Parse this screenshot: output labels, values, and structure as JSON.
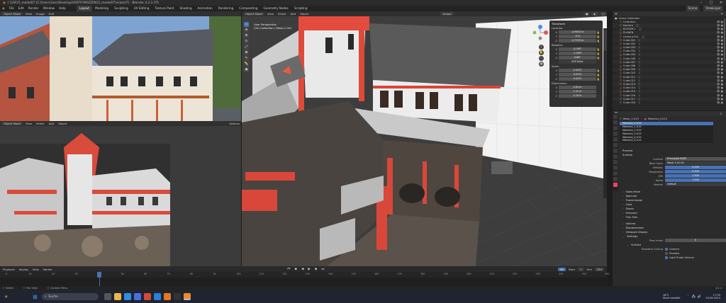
{
  "window": {
    "title": "[ 1GR15_model07 [C:\\Users\\User\\Desktop\\VERTIF\\MOZZIN15_model07\\vilamil7] - Blender 4.2.3 LTS",
    "controls": [
      "–",
      "□",
      "✕"
    ]
  },
  "menu": {
    "items": [
      "File",
      "Edit",
      "Render",
      "Window",
      "Help"
    ],
    "workspaces": [
      "Layout",
      "Modeling",
      "Sculpting",
      "UV Editing",
      "Texture Paint",
      "Shading",
      "Animation",
      "Rendering",
      "Compositing",
      "Geometry Nodes",
      "Scripting"
    ],
    "active_workspace": "Layout",
    "scene_label": "Scene",
    "view_layer_label": "ViewLayer"
  },
  "image_editor": {
    "mode": "Object Mode",
    "items": [
      "View",
      "Image",
      "Edit"
    ]
  },
  "render_editor": {
    "mode": "Object Mode",
    "items": [
      "View",
      "Select",
      "Add",
      "Object"
    ],
    "options_label": "Options"
  },
  "viewport": {
    "mode": "Object Mode",
    "items": [
      "View",
      "Select",
      "Add",
      "Object"
    ],
    "shading": "Global",
    "overlay_title": "User Perspective",
    "overlay_subtitle": "(34) Collection | Mesh.1.001"
  },
  "npanel": {
    "title": "Transform",
    "location_label": "Location:",
    "location": [
      "-4.9903 m",
      "-0 m",
      "-2.7533 m"
    ],
    "rotation_label": "Rotation:",
    "rotation": [
      "-0.762°",
      "-1.099°",
      "0.86°"
    ],
    "rotation_mode": "XYZ Euler",
    "scale_label": "Scale:",
    "scale": [
      "0.0372",
      "0.0372",
      "0.0372"
    ],
    "dimensions_label": "Dimensions:",
    "dimensions": [
      "4.04 m",
      "1.22 m",
      "0.76 m"
    ],
    "axes": [
      "X",
      "Y",
      "Z"
    ]
  },
  "outliner": {
    "root": "Scene Collection",
    "items": [
      {
        "name": "Collection",
        "mat": ""
      },
      {
        "name": "Kamera",
        "mat": "◯"
      },
      {
        "name": "BOSSER.1",
        "mat": "◯"
      },
      {
        "name": "PLANEN",
        "mat": ""
      },
      {
        "name": "Camera.001",
        "mat": "◯"
      },
      {
        "name": "Cube.001",
        "mat": "▽"
      },
      {
        "name": "Cube.002",
        "mat": "▽"
      },
      {
        "name": "Cube.003",
        "mat": "▽"
      },
      {
        "name": "Cube.004",
        "mat": "▽"
      },
      {
        "name": "Cube.005",
        "mat": "▽"
      },
      {
        "name": "Cube.006",
        "mat": "▽"
      },
      {
        "name": "Cube.007",
        "mat": "▽"
      },
      {
        "name": "Cube.008",
        "mat": "▽"
      },
      {
        "name": "Cube.009",
        "mat": "▽"
      },
      {
        "name": "Cube.010",
        "mat": "▽"
      },
      {
        "name": "Cube.011",
        "mat": "▽"
      },
      {
        "name": "Cube.012",
        "mat": "▽"
      },
      {
        "name": "Cube.013",
        "mat": "▽"
      },
      {
        "name": "Cube.014",
        "mat": "▽"
      },
      {
        "name": "Cube.015",
        "mat": "▽"
      },
      {
        "name": "Cube.016",
        "mat": "▽"
      },
      {
        "name": "Cube.017",
        "mat": "▽"
      },
      {
        "name": "Cube.018",
        "mat": "▽"
      }
    ]
  },
  "properties": {
    "object_name": "Mesh_1.015",
    "material_name": "Material_0.015",
    "slots": [
      "Material_0.015",
      "Material_1.015",
      "Material_2.015",
      "Material_3.015",
      "Material_4.015",
      "Material_5.015"
    ],
    "preview_label": "Preview",
    "surface_label": "Surface",
    "surface_value": "Principled BSDF",
    "base_color_label": "Base Color",
    "base_color_value": "Mesh 1.01.00",
    "metallic_label": "Metallic",
    "metallic_value": "0.000",
    "roughness_label": "Roughness",
    "roughness_value": "0.500",
    "ior_label": "IOR",
    "ior_value": "1.500",
    "alpha_label": "Alpha",
    "alpha_value": "1.000",
    "normal_label": "Normal",
    "normal_value": "Default",
    "subsections": [
      "Subsurface",
      "Specular",
      "Transmission",
      "Coat",
      "Sheen",
      "Emission",
      "Thin Film"
    ],
    "volume_label": "Volume",
    "displacement_label": "Displacement",
    "viewport_display_label": "Viewport Display",
    "settings_label": "Settings",
    "pass_index_label": "Pass Index",
    "pass_index_value": "0",
    "surface2_label": "Surface",
    "backface_label": "Backface Culling",
    "backface_options": [
      "Camera",
      "Shadow",
      "Light Probe Volume"
    ]
  },
  "timeline": {
    "items": [
      "Playback",
      "Keying",
      "View",
      "Marker"
    ],
    "current_frame": "34",
    "start_label": "Start",
    "start": "1",
    "end_label": "End",
    "end": "250",
    "ticks": [
      "0",
      "10",
      "20",
      "30",
      "40",
      "50",
      "60",
      "70",
      "80",
      "90",
      "100",
      "110",
      "120",
      "130",
      "140",
      "150",
      "160",
      "170",
      "180",
      "190",
      "200",
      "210",
      "220",
      "230",
      "240",
      "250",
      "260"
    ]
  },
  "statusbar": {
    "left": "Select",
    "mid": "Pan View",
    "right": "Context Menu",
    "version": "4.2.3"
  },
  "taskbar": {
    "search_placeholder": "Suche",
    "weather": "18°C",
    "weather_desc": "Stark bewölkt",
    "time": "17:59",
    "date": "04.08.2024"
  },
  "colors": {
    "accent_blue": "#4772b3",
    "active_orange": "#f0a35e",
    "timeline_playhead": "#4772b3"
  }
}
